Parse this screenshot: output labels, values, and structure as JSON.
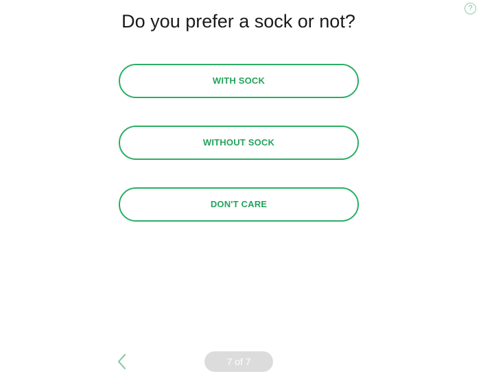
{
  "help": {
    "label": "?"
  },
  "question": {
    "title": "Do you prefer a sock or not?"
  },
  "options": [
    {
      "label": "WITH SOCK"
    },
    {
      "label": "WITHOUT SOCK"
    },
    {
      "label": "DON'T CARE"
    }
  ],
  "footer": {
    "back_icon": "chevron-left-icon",
    "progress": "7 of 7"
  },
  "colors": {
    "accent": "#2aae62",
    "progress_bg": "#dcdcdc"
  }
}
